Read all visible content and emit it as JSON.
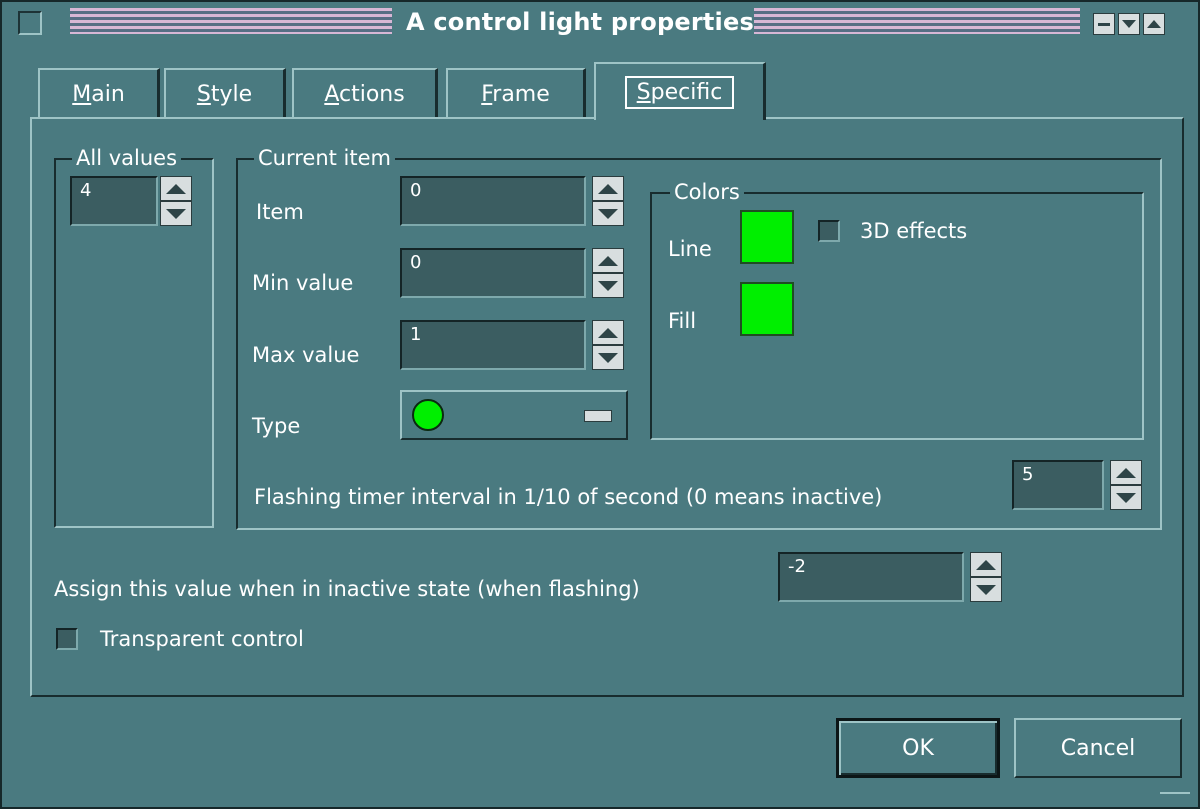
{
  "window": {
    "title": "A control light properties"
  },
  "tabs": [
    {
      "label": "Main",
      "mnemonic": "M",
      "rest": "ain"
    },
    {
      "label": "Style",
      "mnemonic": "S",
      "rest": "tyle"
    },
    {
      "label": "Actions",
      "mnemonic": "A",
      "rest": "ctions"
    },
    {
      "label": "Frame",
      "mnemonic": "F",
      "rest": "rame"
    },
    {
      "label": "Specific",
      "mnemonic": "S",
      "rest": "pecific",
      "active": true
    }
  ],
  "all_values": {
    "legend": "All values",
    "value": "4"
  },
  "current_item": {
    "legend": "Current item",
    "item_label": "Item",
    "item_value": "0",
    "min_label": "Min value",
    "min_value": "0",
    "max_label": "Max value",
    "max_value": "1",
    "type_label": "Type",
    "type_shape": "circle"
  },
  "colors": {
    "legend": "Colors",
    "line_label": "Line",
    "line_color": "#00ef00",
    "fill_label": "Fill",
    "fill_color": "#00ef00",
    "effects_label": "3D effects",
    "effects_checked": false
  },
  "flashing": {
    "label": "Flashing timer interval in 1/10 of second (0 means inactive)",
    "value": "5"
  },
  "inactive": {
    "label": "Assign this value when in inactive state (when flashing)",
    "value": "-2"
  },
  "transparent": {
    "label": "Transparent control",
    "checked": false
  },
  "buttons": {
    "ok": "OK",
    "cancel": "Cancel"
  }
}
